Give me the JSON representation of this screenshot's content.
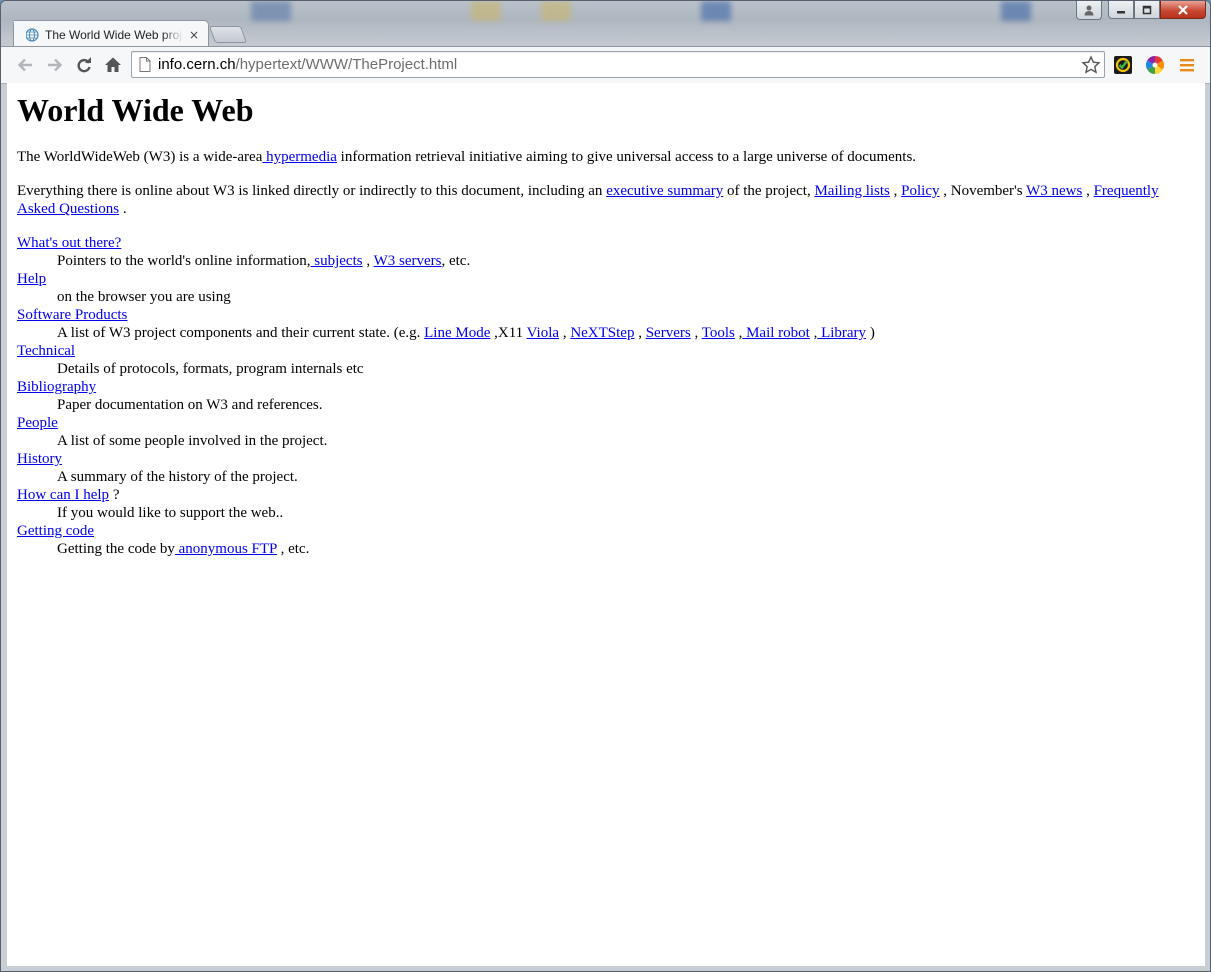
{
  "browser": {
    "tab_title": "The World Wide Web project",
    "tab_close": "×",
    "url_host": "info.cern.ch",
    "url_path": "/hypertext/WWW/TheProject.html"
  },
  "page": {
    "heading": "World Wide Web",
    "intro": {
      "before": "The WorldWideWeb (W3) is a wide-area",
      "link": " hypermedia",
      "after": " information retrieval initiative aiming to give universal access to a large universe of documents."
    },
    "summary": {
      "t1": "Everything there is online about W3 is linked directly or indirectly to this document, including an ",
      "l1": "executive summary",
      "t2": " of the project, ",
      "l2": "Mailing lists",
      "t3": " , ",
      "l3": "Policy",
      "t4": " , November's ",
      "l4": "W3 news",
      "t5": " , ",
      "l5": "Frequently Asked Questions",
      "t6": " ."
    },
    "items": [
      {
        "term": "What's out there?",
        "d1": "Pointers to the world's online information,",
        "dl1": " subjects",
        "d2": " , ",
        "dl2": "W3 servers",
        "d3": ", etc."
      },
      {
        "term": "Help",
        "d1": "on the browser you are using"
      },
      {
        "term": "Software Products",
        "d1": "A list of W3 project components and their current state. (e.g. ",
        "links": [
          "Line Mode",
          "Viola",
          "NeXTStep",
          "Servers",
          "Tools",
          " Mail robot",
          " Library"
        ],
        "seps": [
          " ,X11 ",
          " , ",
          " , ",
          " , ",
          " ,",
          " ,",
          " )"
        ]
      },
      {
        "term": "Technical",
        "d1": "Details of protocols, formats, program internals etc"
      },
      {
        "term": "Bibliography",
        "d1": "Paper documentation on W3 and references."
      },
      {
        "term": "People",
        "d1": "A list of some people involved in the project."
      },
      {
        "term": "History",
        "d1": "A summary of the history of the project."
      },
      {
        "term": "How can I help",
        "term_suffix": " ?",
        "d1": "If you would like to support the web.."
      },
      {
        "term": "Getting code",
        "d1": "Getting the code by",
        "dl1": " anonymous FTP",
        "d2": " , etc."
      }
    ]
  },
  "colors": {
    "link": "#0000ee",
    "close_button": "#c7442e"
  }
}
